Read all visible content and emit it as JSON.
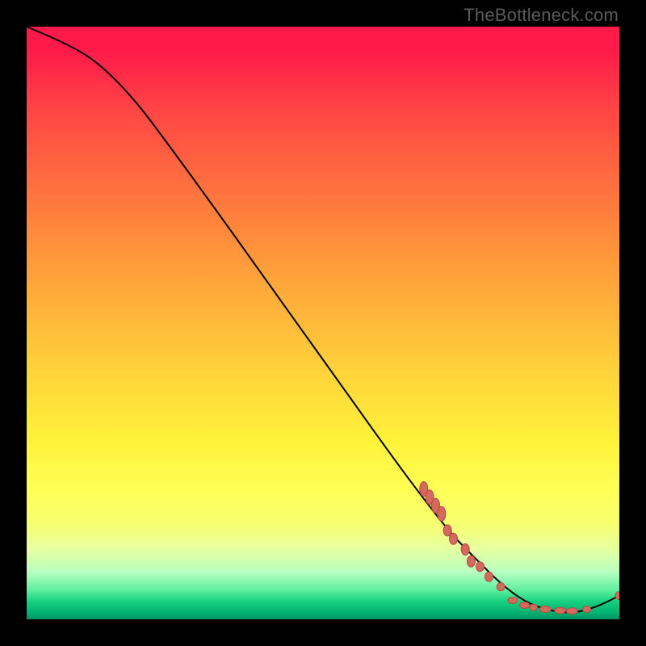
{
  "watermark": "TheBottleneck.com",
  "chart_data": {
    "type": "line",
    "title": "",
    "xlabel": "",
    "ylabel": "",
    "xlim": [
      0,
      100
    ],
    "ylim": [
      0,
      100
    ],
    "grid": false,
    "legend": false,
    "series": [
      {
        "name": "curve",
        "points": [
          {
            "x": 0,
            "y": 100
          },
          {
            "x": 7,
            "y": 97
          },
          {
            "x": 12,
            "y": 94
          },
          {
            "x": 18,
            "y": 88
          },
          {
            "x": 24,
            "y": 80
          },
          {
            "x": 32,
            "y": 69
          },
          {
            "x": 42,
            "y": 55
          },
          {
            "x": 52,
            "y": 41
          },
          {
            "x": 62,
            "y": 27
          },
          {
            "x": 68,
            "y": 19
          },
          {
            "x": 72,
            "y": 14
          },
          {
            "x": 76,
            "y": 10
          },
          {
            "x": 80,
            "y": 6
          },
          {
            "x": 84,
            "y": 3
          },
          {
            "x": 88,
            "y": 1.5
          },
          {
            "x": 92,
            "y": 1
          },
          {
            "x": 96,
            "y": 2
          },
          {
            "x": 100,
            "y": 4
          }
        ]
      }
    ],
    "markers": [
      {
        "x": 67,
        "y": 22.0,
        "rx": 5,
        "ry": 9
      },
      {
        "x": 68,
        "y": 20.6,
        "rx": 5,
        "ry": 9
      },
      {
        "x": 69,
        "y": 19.2,
        "rx": 5,
        "ry": 9
      },
      {
        "x": 70,
        "y": 17.8,
        "rx": 5,
        "ry": 9
      },
      {
        "x": 71,
        "y": 15.0,
        "rx": 5,
        "ry": 7
      },
      {
        "x": 72,
        "y": 13.6,
        "rx": 5,
        "ry": 7
      },
      {
        "x": 74,
        "y": 11.8,
        "rx": 5,
        "ry": 7
      },
      {
        "x": 75,
        "y": 9.8,
        "rx": 5,
        "ry": 7
      },
      {
        "x": 76.5,
        "y": 8.9,
        "rx": 5,
        "ry": 6
      },
      {
        "x": 78,
        "y": 7.2,
        "rx": 5,
        "ry": 6
      },
      {
        "x": 80,
        "y": 5.5,
        "rx": 5,
        "ry": 5
      },
      {
        "x": 82,
        "y": 3.2,
        "rx": 6,
        "ry": 4
      },
      {
        "x": 84,
        "y": 2.4,
        "rx": 6,
        "ry": 4
      },
      {
        "x": 85.5,
        "y": 2.0,
        "rx": 5,
        "ry": 4
      },
      {
        "x": 87.5,
        "y": 1.7,
        "rx": 7,
        "ry": 4
      },
      {
        "x": 90,
        "y": 1.5,
        "rx": 7,
        "ry": 4
      },
      {
        "x": 92,
        "y": 1.4,
        "rx": 7,
        "ry": 4
      },
      {
        "x": 94.5,
        "y": 1.7,
        "rx": 5,
        "ry": 4
      },
      {
        "x": 100,
        "y": 4.0,
        "rx": 5,
        "ry": 5
      }
    ]
  }
}
